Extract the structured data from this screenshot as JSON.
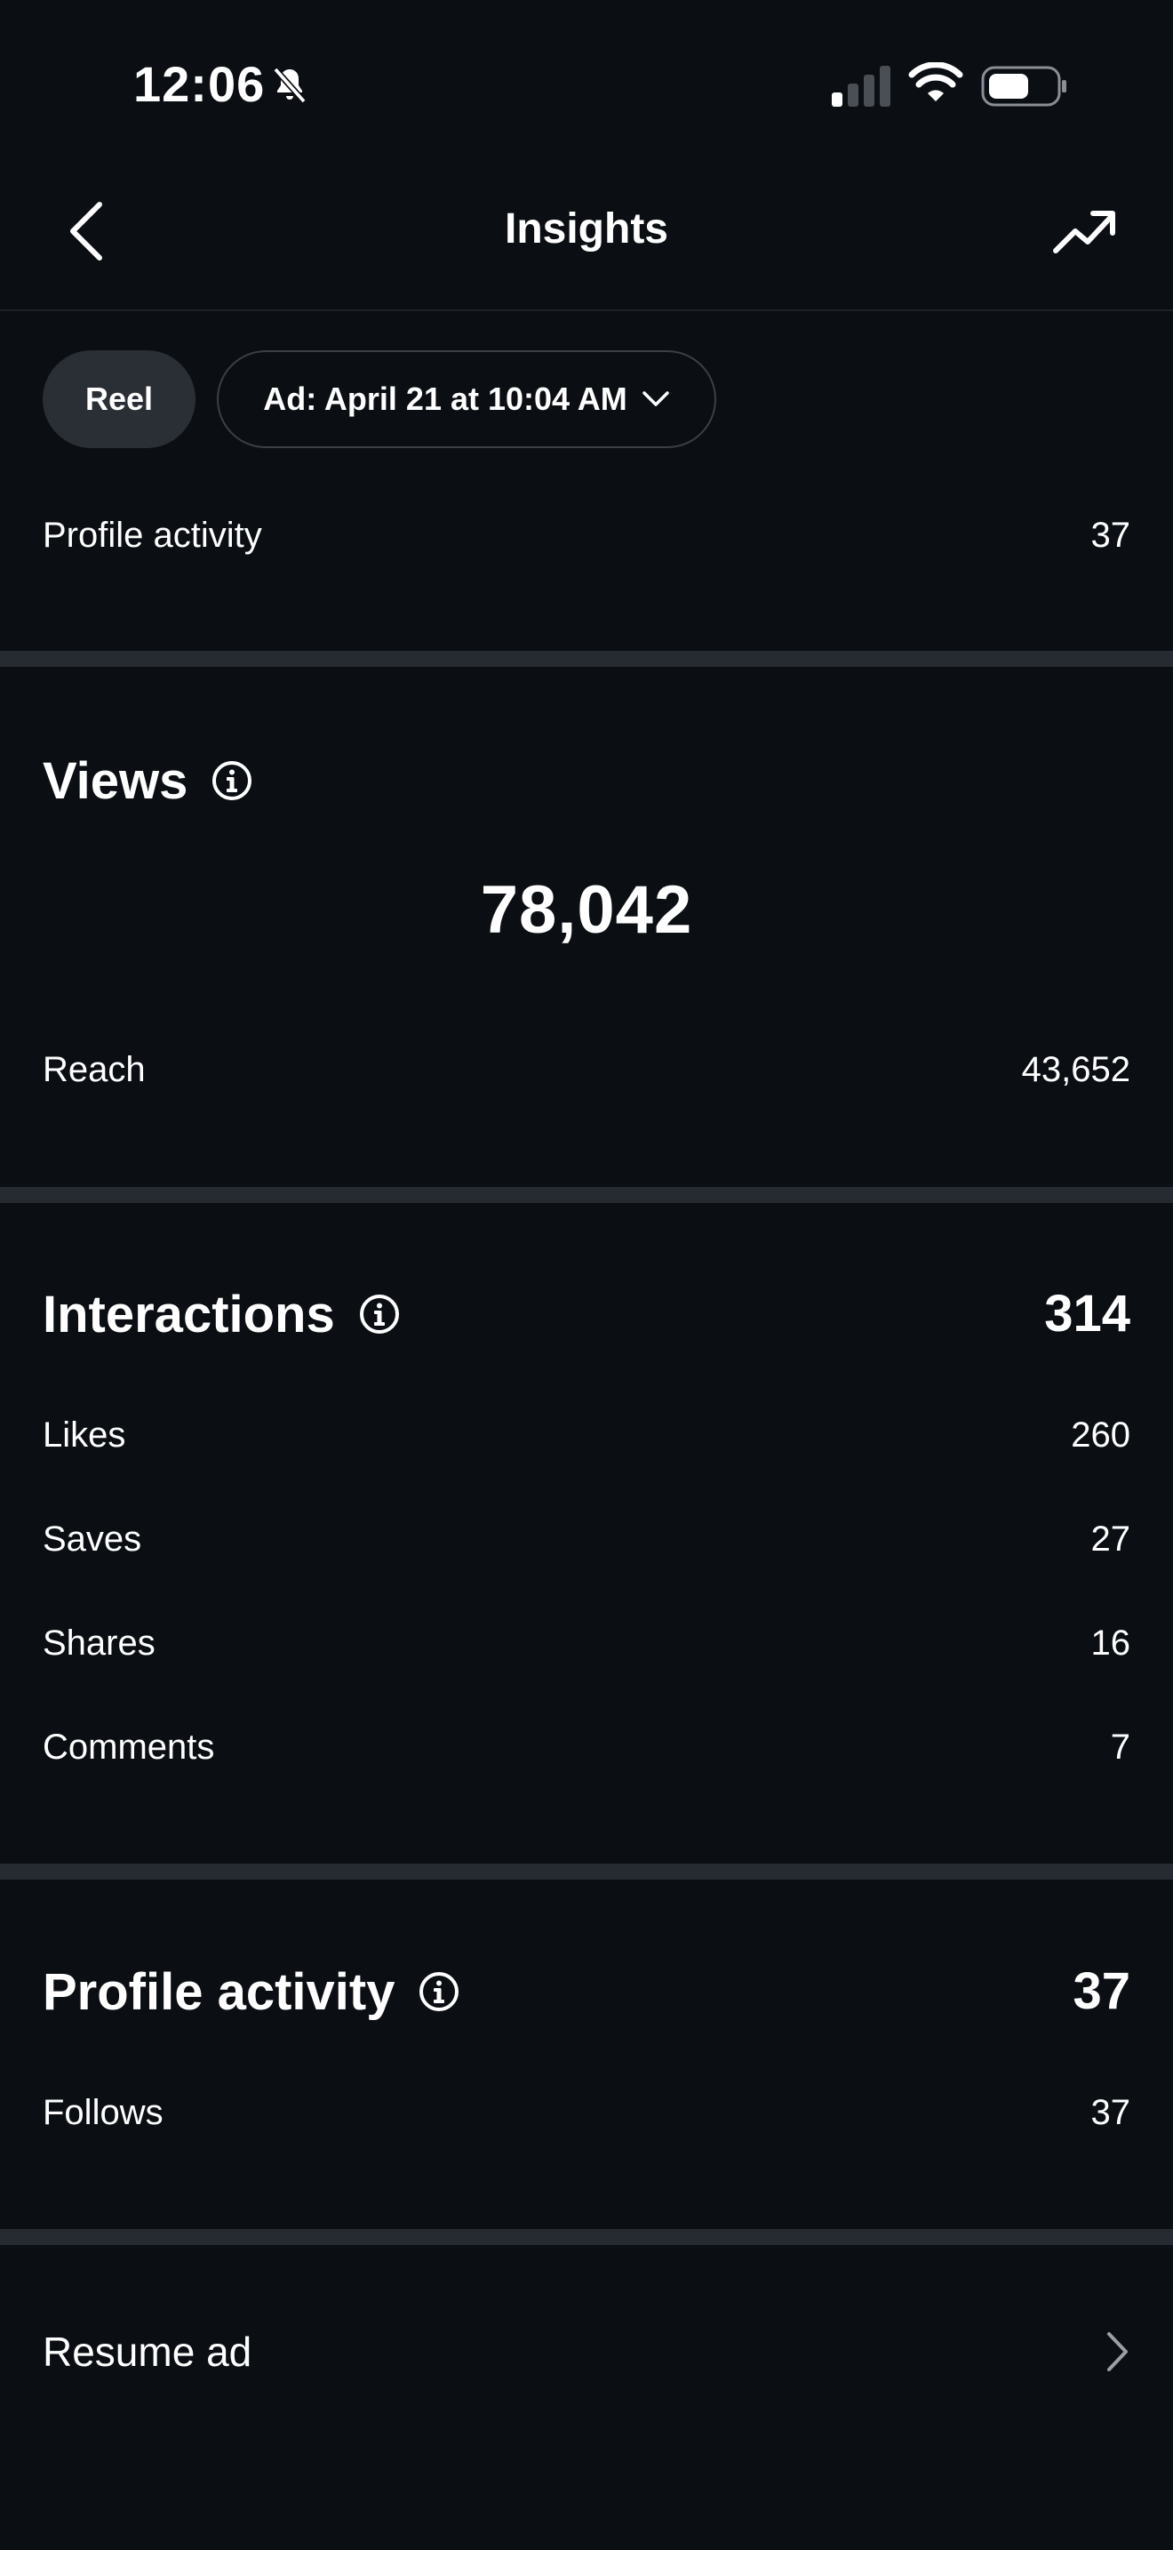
{
  "status_bar": {
    "time": "12:06"
  },
  "nav": {
    "title": "Insights"
  },
  "chips": {
    "reel": "Reel",
    "ad": "Ad: April 21 at 10:04 AM"
  },
  "summary": {
    "label": "Profile activity",
    "value": "37"
  },
  "views": {
    "title": "Views",
    "total": "78,042",
    "rows": [
      {
        "label": "Reach",
        "value": "43,652"
      }
    ]
  },
  "interactions": {
    "title": "Interactions",
    "total": "314",
    "rows": [
      {
        "label": "Likes",
        "value": "260"
      },
      {
        "label": "Saves",
        "value": "27"
      },
      {
        "label": "Shares",
        "value": "16"
      },
      {
        "label": "Comments",
        "value": "7"
      }
    ]
  },
  "profile_activity": {
    "title": "Profile activity",
    "total": "37",
    "rows": [
      {
        "label": "Follows",
        "value": "37"
      }
    ]
  },
  "resume": {
    "label": "Resume ad"
  },
  "icons": {
    "back": "chevron-left-icon",
    "trend": "trending-up-icon",
    "info": "info-icon",
    "bell": "bell-slash-icon",
    "signal": "cellular-signal-icon",
    "wifi": "wifi-icon",
    "battery": "battery-icon",
    "chevron_down": "chevron-down-icon",
    "chevron_right": "chevron-right-icon"
  },
  "colors": {
    "background": "#0b0f14",
    "chip": "#2a2f35",
    "divider": "#262b31",
    "text": "#ffffff"
  }
}
